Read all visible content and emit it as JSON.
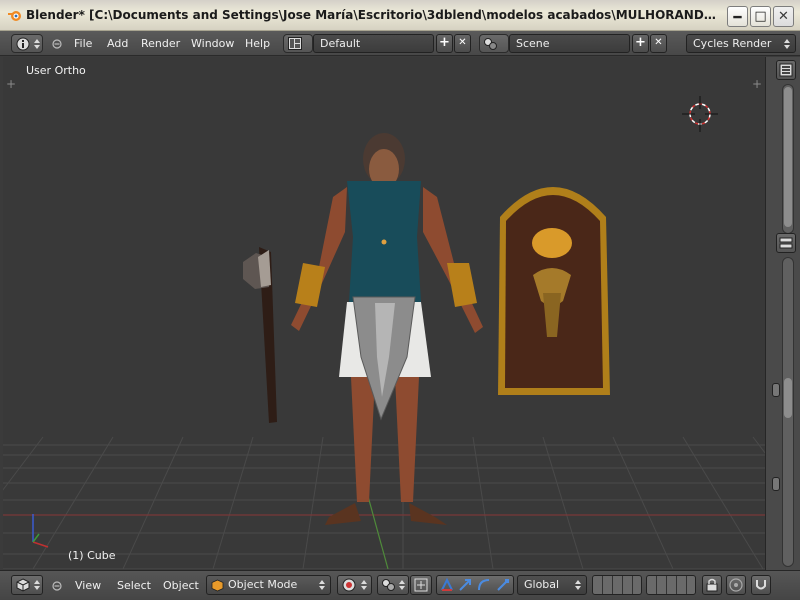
{
  "window": {
    "title": "Blender* [C:\\Documents and Settings\\Jose María\\Escritorio\\3dblend\\modelos acabados\\MULHORAND\\skuld gua...",
    "minimize_glyph": "🗕",
    "maximize_glyph": "□",
    "close_glyph": "✕"
  },
  "info_header": {
    "menus": [
      "File",
      "Add",
      "Render",
      "Window",
      "Help"
    ],
    "layout": "Default",
    "scene": "Scene",
    "render_engine": "Cycles Render",
    "add_glyph": "+",
    "remove_glyph": "✕"
  },
  "viewport": {
    "view_label": "User Ortho",
    "object_label": "(1) Cube"
  },
  "view3d_header": {
    "menus": [
      "View",
      "Select",
      "Object"
    ],
    "mode": "Object Mode",
    "orientation": "Global"
  },
  "colors": {
    "accent_blue": "#3a6ea5",
    "header_gray": "#4c4c4c",
    "viewport_bg": "#393939",
    "grid_red_axis": "#8a3a3a",
    "grid_green_axis": "#4e8a3a"
  }
}
